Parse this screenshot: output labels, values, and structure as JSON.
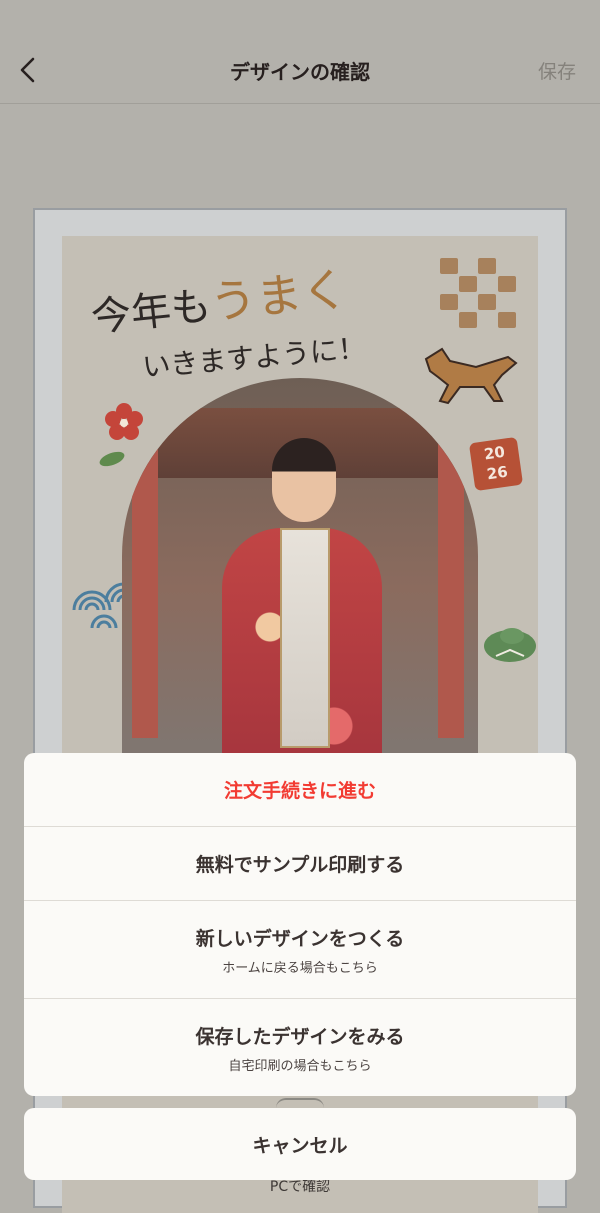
{
  "header": {
    "title": "デザインの確認",
    "save_label": "保存"
  },
  "card": {
    "line1_part1": "今年も",
    "line1_accent": "うまく",
    "line2": "いきますように！",
    "year_top": "20",
    "year_bottom": "26"
  },
  "sheet": {
    "items": [
      {
        "label": "注文手続きに進む",
        "sub": ""
      },
      {
        "label": "無料でサンプル印刷する",
        "sub": ""
      },
      {
        "label": "新しいデザインをつくる",
        "sub": "ホームに戻る場合もこちら"
      },
      {
        "label": "保存したデザインをみる",
        "sub": "自宅印刷の場合もこちら"
      }
    ],
    "cancel_label": "キャンセル"
  },
  "footer": {
    "pc_confirm": "PCで確認"
  },
  "colors": {
    "overlay": "#b3b1ab",
    "primary_red": "#f23b32",
    "sheet_bg": "#fbfaf7"
  }
}
